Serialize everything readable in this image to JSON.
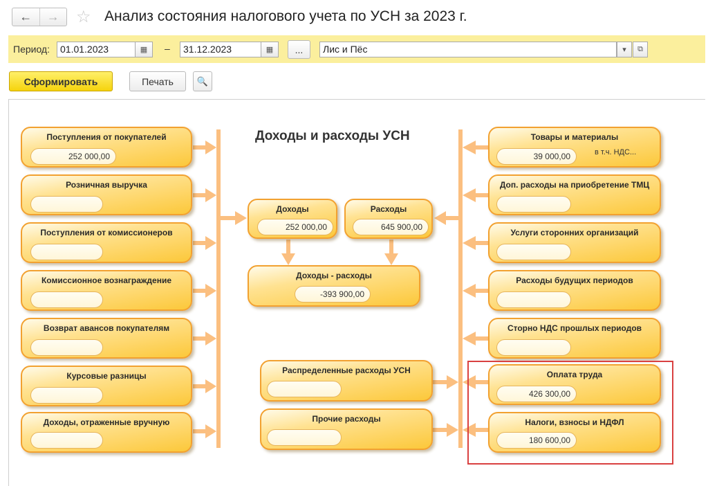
{
  "header": {
    "back_icon": "arrow-left-icon",
    "forward_icon": "arrow-right-icon",
    "favorite_icon": "star-icon",
    "title": "Анализ состояния налогового учета по УСН за 2023 г."
  },
  "period": {
    "label": "Период:",
    "from": "01.01.2023",
    "dash": "–",
    "to": "31.12.2023",
    "select_button": "...",
    "organization": "Лис и Пёс"
  },
  "toolbar": {
    "generate": "Сформировать",
    "print": "Печать",
    "preview_icon": "print-preview-icon"
  },
  "report": {
    "title": "Доходы и расходы УСН",
    "income_items": [
      {
        "label": "Поступления от покупателей",
        "value": "252 000,00"
      },
      {
        "label": "Розничная выручка",
        "value": ""
      },
      {
        "label": "Поступления от комиссионеров",
        "value": ""
      },
      {
        "label": "Комиссионное вознаграждение",
        "value": ""
      },
      {
        "label": "Возврат авансов покупателям",
        "value": ""
      },
      {
        "label": "Курсовые разницы",
        "value": ""
      },
      {
        "label": "Доходы, отраженные вручную",
        "value": ""
      }
    ],
    "center": {
      "income": {
        "label": "Доходы",
        "value": "252 000,00"
      },
      "expenses": {
        "label": "Расходы",
        "value": "645 900,00"
      },
      "difference": {
        "label": "Доходы - расходы",
        "value": "-393 900,00"
      },
      "distributed": {
        "label": "Распределенные расходы УСН",
        "value": ""
      },
      "other": {
        "label": "Прочие расходы",
        "value": ""
      }
    },
    "expense_items": [
      {
        "label": "Товары и материалы",
        "value": "39 000,00",
        "note": "в т.ч. НДС..."
      },
      {
        "label": "Доп. расходы на приобретение ТМЦ",
        "value": ""
      },
      {
        "label": "Услуги сторонних организаций",
        "value": ""
      },
      {
        "label": "Расходы будущих периодов",
        "value": ""
      },
      {
        "label": "Сторно НДС прошлых периодов",
        "value": ""
      },
      {
        "label": "Оплата труда",
        "value": "426 300,00"
      },
      {
        "label": "Налоги, взносы и НДФЛ",
        "value": "180 600,00"
      }
    ]
  }
}
